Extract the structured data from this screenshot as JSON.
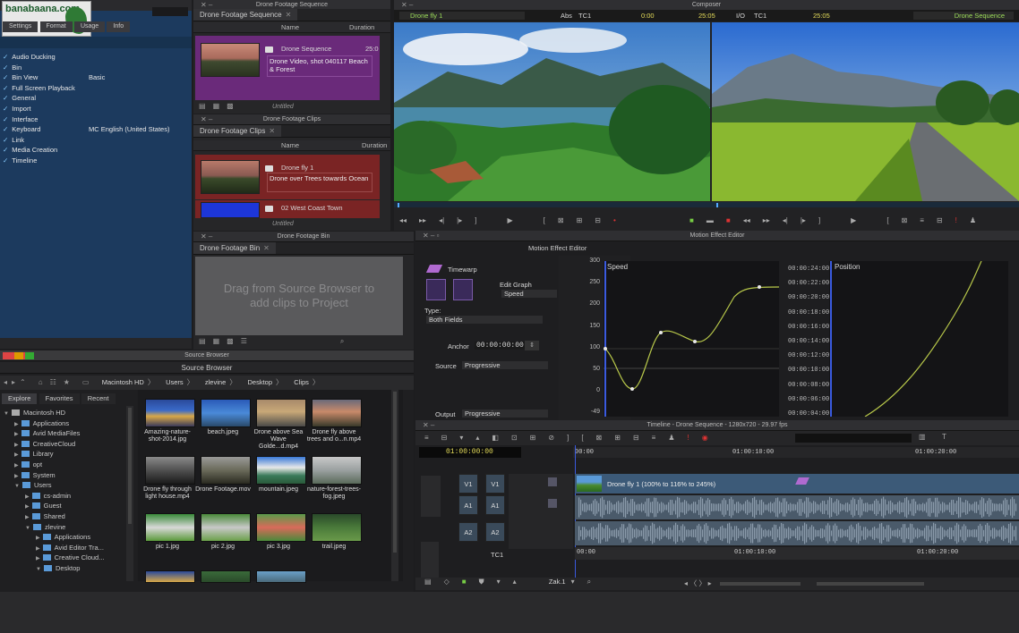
{
  "watermark": "banabaana.com",
  "settings": {
    "tabs": [
      "Settings",
      "Format",
      "Usage",
      "Info"
    ],
    "items": [
      {
        "label": "Audio Ducking",
        "value": ""
      },
      {
        "label": "Bin",
        "value": ""
      },
      {
        "label": "Bin View",
        "value": "Basic"
      },
      {
        "label": "Full Screen Playback",
        "value": ""
      },
      {
        "label": "General",
        "value": ""
      },
      {
        "label": "Import",
        "value": ""
      },
      {
        "label": "Interface",
        "value": ""
      },
      {
        "label": "Keyboard",
        "value": "MC English (United States)"
      },
      {
        "label": "Link",
        "value": ""
      },
      {
        "label": "Media Creation",
        "value": ""
      },
      {
        "label": "Timeline",
        "value": ""
      }
    ]
  },
  "seq_bin": {
    "title": "Drone Footage Sequence",
    "tab": "Drone Footage Sequence",
    "col_name": "Name",
    "col_dur": "Duration",
    "item_name": "Drone Sequence",
    "item_dur": "25:0",
    "item_desc": "Drone Video, shot 040117 Beach & Forest",
    "footer": "Untitled"
  },
  "clips_bin": {
    "title": "Drone Footage Clips",
    "tab": "Drone Footage Clips",
    "col_name": "Name",
    "col_dur": "Duration",
    "item1_name": "Drone fly 1",
    "item1_desc": "Drone over Trees towards Ocean",
    "item2_name": "02 West Coast Town",
    "footer": "Untitled"
  },
  "footage_bin": {
    "title": "Drone Footage Bin",
    "tab": "Drone Footage Bin",
    "placeholder": "Drag from Source Browser to add clips to Project"
  },
  "composer": {
    "title": "Composer",
    "source_name": "Drone fly 1",
    "abs": "Abs",
    "tc1": "TC1",
    "tc_src": "0:00",
    "tc_dur": "25:05",
    "io": "I/O",
    "tc1b": "TC1",
    "tc_rec": "25:05",
    "record_name": "Drone Sequence"
  },
  "motion": {
    "title": "Motion Effect Editor",
    "subtitle": "Motion Effect Editor",
    "timewarp": "Timewarp",
    "edit_graph_label": "Edit Graph",
    "edit_graph_value": "Speed",
    "type_label": "Type:",
    "type_value": "Both Fields",
    "anchor_label": "Anchor",
    "anchor_value": "00:00:00:00",
    "source_label": "Source",
    "source_value": "Progressive",
    "output_label": "Output",
    "output_value": "Progressive",
    "speed_title": "Speed",
    "position_title": "Position",
    "speed_ticks": [
      "300",
      "250",
      "200",
      "150",
      "100",
      "50",
      "0",
      "-49"
    ],
    "position_ticks": [
      "00:00:24:00",
      "00:00:22:00",
      "00:00:20:00",
      "00:00:18:00",
      "00:00:16:00",
      "00:00:14:00",
      "00:00:12:00",
      "00:00:10:00",
      "00:00:08:00",
      "00:00:06:00",
      "00:00:04:00"
    ]
  },
  "source_browser": {
    "title": "Source Browser",
    "tab": "Source Browser",
    "path": [
      "Macintosh HD",
      "Users",
      "zlevine",
      "Desktop",
      "Clips"
    ],
    "subtabs": [
      "Explore",
      "Favorites",
      "Recent"
    ],
    "tree": [
      {
        "label": "Macintosh HD",
        "depth": 0,
        "open": true
      },
      {
        "label": "Applications",
        "depth": 1
      },
      {
        "label": "Avid MediaFiles",
        "depth": 1
      },
      {
        "label": "CreativeCloud",
        "depth": 1
      },
      {
        "label": "Library",
        "depth": 1
      },
      {
        "label": "opt",
        "depth": 1
      },
      {
        "label": "System",
        "depth": 1
      },
      {
        "label": "Users",
        "depth": 1,
        "open": true
      },
      {
        "label": "cs-admin",
        "depth": 2
      },
      {
        "label": "Guest",
        "depth": 2
      },
      {
        "label": "Shared",
        "depth": 2
      },
      {
        "label": "zlevine",
        "depth": 2,
        "open": true
      },
      {
        "label": "Applications",
        "depth": 3
      },
      {
        "label": "Avid Editor Tra...",
        "depth": 3
      },
      {
        "label": "Creative Cloud...",
        "depth": 3
      },
      {
        "label": "Desktop",
        "depth": 3,
        "open": true
      }
    ],
    "files": [
      "Amazing-nature-shot-2014.jpg",
      "beach.jpeg",
      "Drone above Sea Wave Golde...d.mp4",
      "Drone fly above trees and o...n.mp4",
      "Drone fly through light house.mp4",
      "Drone Footage.mov",
      "mountain.jpeg",
      "nature-forest-trees-fog.jpeg",
      "pic 1.jpg",
      "pic 2.jpg",
      "pic 3.jpg",
      "trail.jpeg"
    ]
  },
  "timeline": {
    "title": "Timeline - Drone Sequence - 1280x720 - 29.97 fps",
    "timecode": "01:00:00:00",
    "ruler": [
      "00:00",
      "01:00:10:00",
      "01:00:20:00"
    ],
    "clip_label": "Drone fly 1 (100% to 116% to 245%)",
    "tracks": [
      "V1",
      "A1",
      "A2",
      "TC1"
    ],
    "src_tracks": [
      "V1",
      "A1",
      "A2"
    ],
    "zoom_label": "Zak.1"
  },
  "colors": {
    "accent": "#7bc043",
    "purple": "#6a2a7a",
    "red": "#7a2424",
    "blue": "#1c3a5e"
  }
}
